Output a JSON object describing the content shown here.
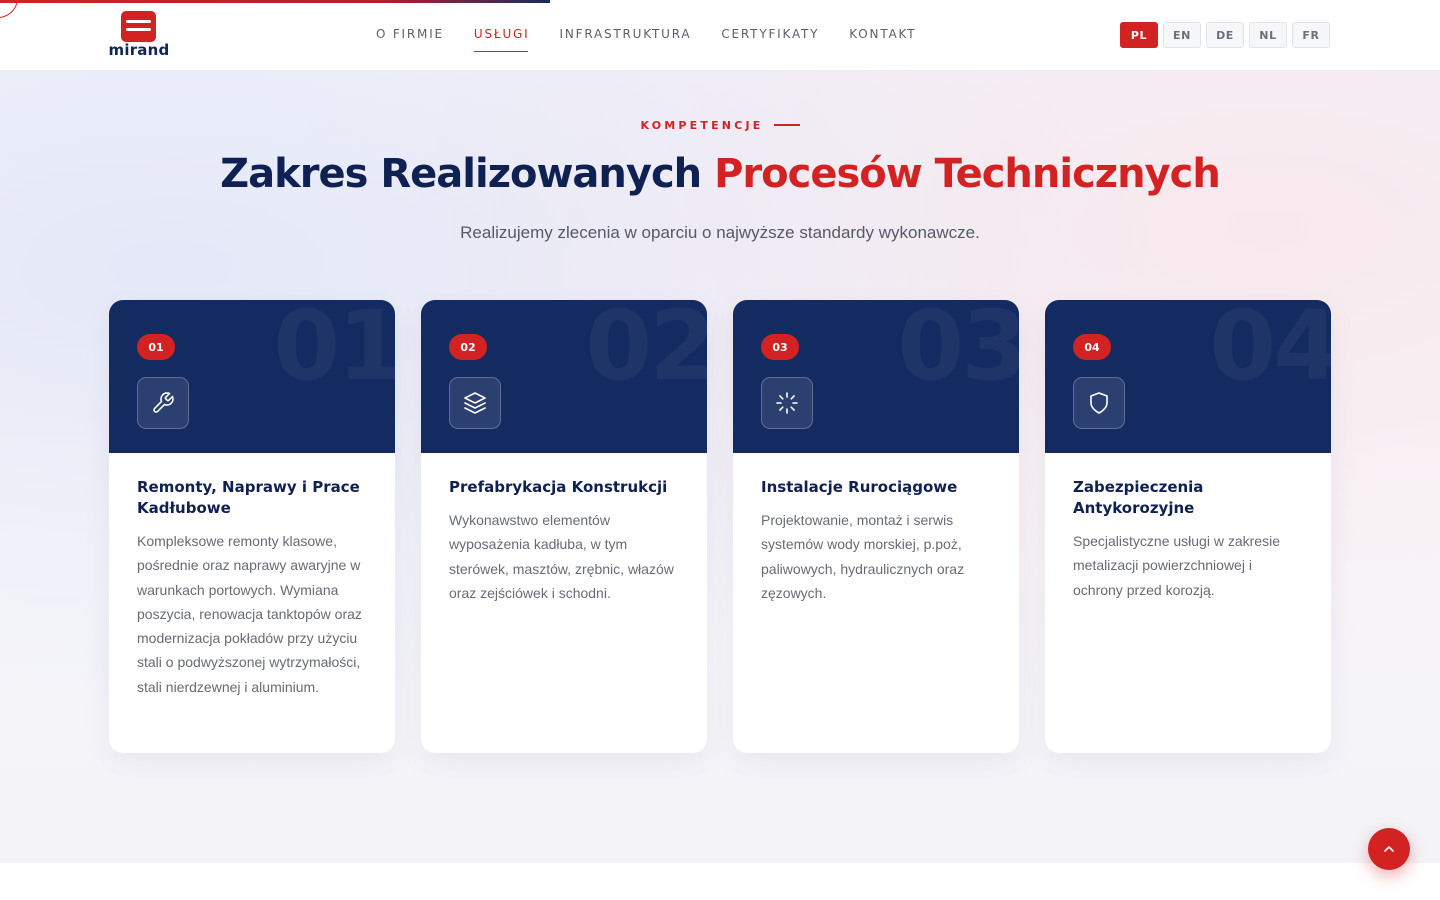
{
  "brand": {
    "name": "mirand",
    "accent": "#d32222",
    "navy": "#132b60"
  },
  "nav": {
    "items": [
      {
        "label": "O FIRMIE",
        "active": false
      },
      {
        "label": "USŁUGI",
        "active": true
      },
      {
        "label": "INFRASTRUKTURA",
        "active": false
      },
      {
        "label": "CERTYFIKATY",
        "active": false
      },
      {
        "label": "KONTAKT",
        "active": false
      }
    ]
  },
  "languages": {
    "selected": "PL",
    "options": [
      "PL",
      "EN",
      "DE",
      "NL",
      "FR"
    ]
  },
  "section": {
    "eyebrow": "KOMPETENCJE",
    "title_part1": "Zakres Realizowanych",
    "title_part2": "Procesów Technicznych",
    "subtitle": "Realizujemy zlecenia w oparciu o najwyższe standardy wykonawcze."
  },
  "cards": [
    {
      "number": "01",
      "icon": "wrench-icon",
      "title": "Remonty, Naprawy i Prace Kadłubowe",
      "text": "Kompleksowe remonty klasowe, pośrednie oraz naprawy awaryjne w warunkach portowych. Wymiana poszycia, renowacja tanktopów oraz modernizacja pokładów przy użyciu stali o podwyższonej wytrzymałości, stali nierdzewnej i aluminium."
    },
    {
      "number": "02",
      "icon": "layers-icon",
      "title": "Prefabrykacja Konstrukcji",
      "text": "Wykonawstwo elementów wyposażenia kadłuba, w tym sterówek, masztów, zrębnic, włazów oraz zejściówek i schodni."
    },
    {
      "number": "03",
      "icon": "loader-icon",
      "title": "Instalacje Rurociągowe",
      "text": "Projektowanie, montaż i serwis systemów wody morskiej, p.poż, paliwowych, hydraulicznych oraz zęzowych."
    },
    {
      "number": "04",
      "icon": "shield-icon",
      "title": "Zabezpieczenia Antykorozyjne",
      "text": "Specjalistyczne usługi w zakresie metalizacji powierzchniowej i ochrony przed korozją."
    }
  ],
  "scroll_top": {
    "icon": "chevron-up-icon"
  }
}
